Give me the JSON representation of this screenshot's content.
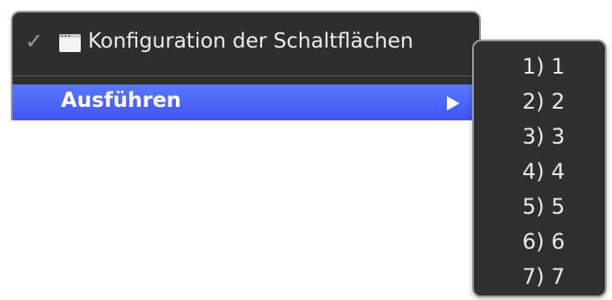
{
  "main_menu": {
    "config_item": {
      "label": "Konfiguration der Schaltflächen",
      "checked": true,
      "icon": "window-icon"
    },
    "run_item": {
      "label": "Ausführen",
      "highlighted": true,
      "submenu_icon": "chevron-right-icon"
    }
  },
  "submenu": {
    "items": [
      {
        "label": "1) 1"
      },
      {
        "label": "2) 2"
      },
      {
        "label": "3) 3"
      },
      {
        "label": "4) 4"
      },
      {
        "label": "5) 5"
      },
      {
        "label": "6) 6"
      },
      {
        "label": "7) 7"
      }
    ]
  },
  "colors": {
    "menu_background": "#2e2e2e",
    "highlight": "#4a64f8",
    "text": "#ededed"
  }
}
